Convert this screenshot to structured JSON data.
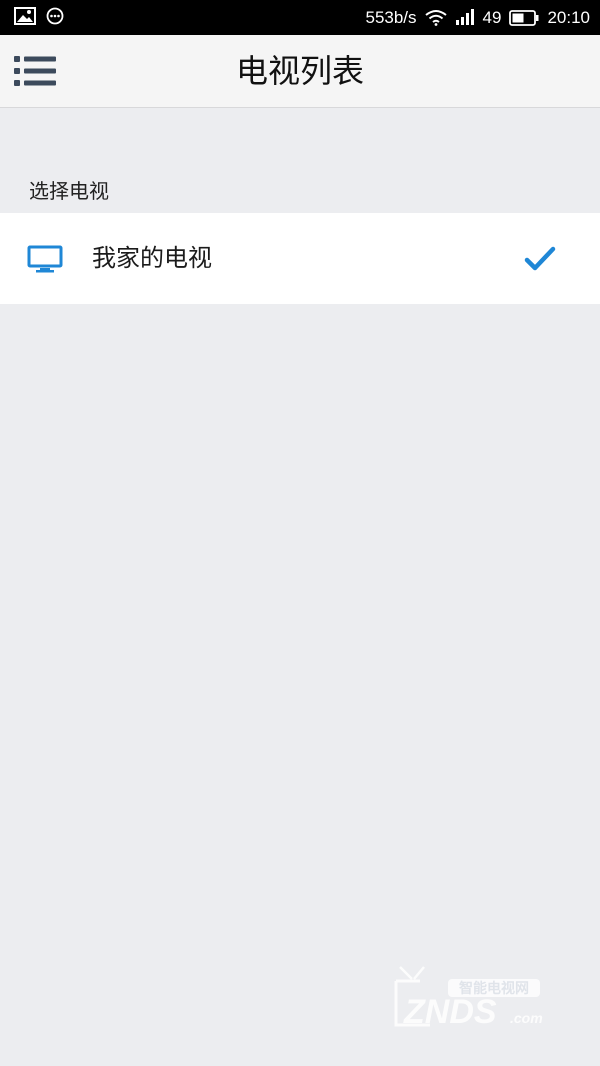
{
  "status_bar": {
    "network_speed": "553b/s",
    "battery_level": "49",
    "time": "20:10"
  },
  "app_bar": {
    "title": "电视列表",
    "menu_icon": "menu-icon"
  },
  "section": {
    "header": "选择电视"
  },
  "tv_list": {
    "items": [
      {
        "name": "我家的电视",
        "icon": "tv-icon",
        "selected": true
      }
    ]
  },
  "watermark": {
    "tagline": "智能电视网",
    "brand": "ZNDS",
    "domain": ".com"
  },
  "colors": {
    "accent": "#1f87d6",
    "background": "#ecedf0",
    "app_bar": "#f5f5f5",
    "menu_icon": "#3c4a5c"
  }
}
